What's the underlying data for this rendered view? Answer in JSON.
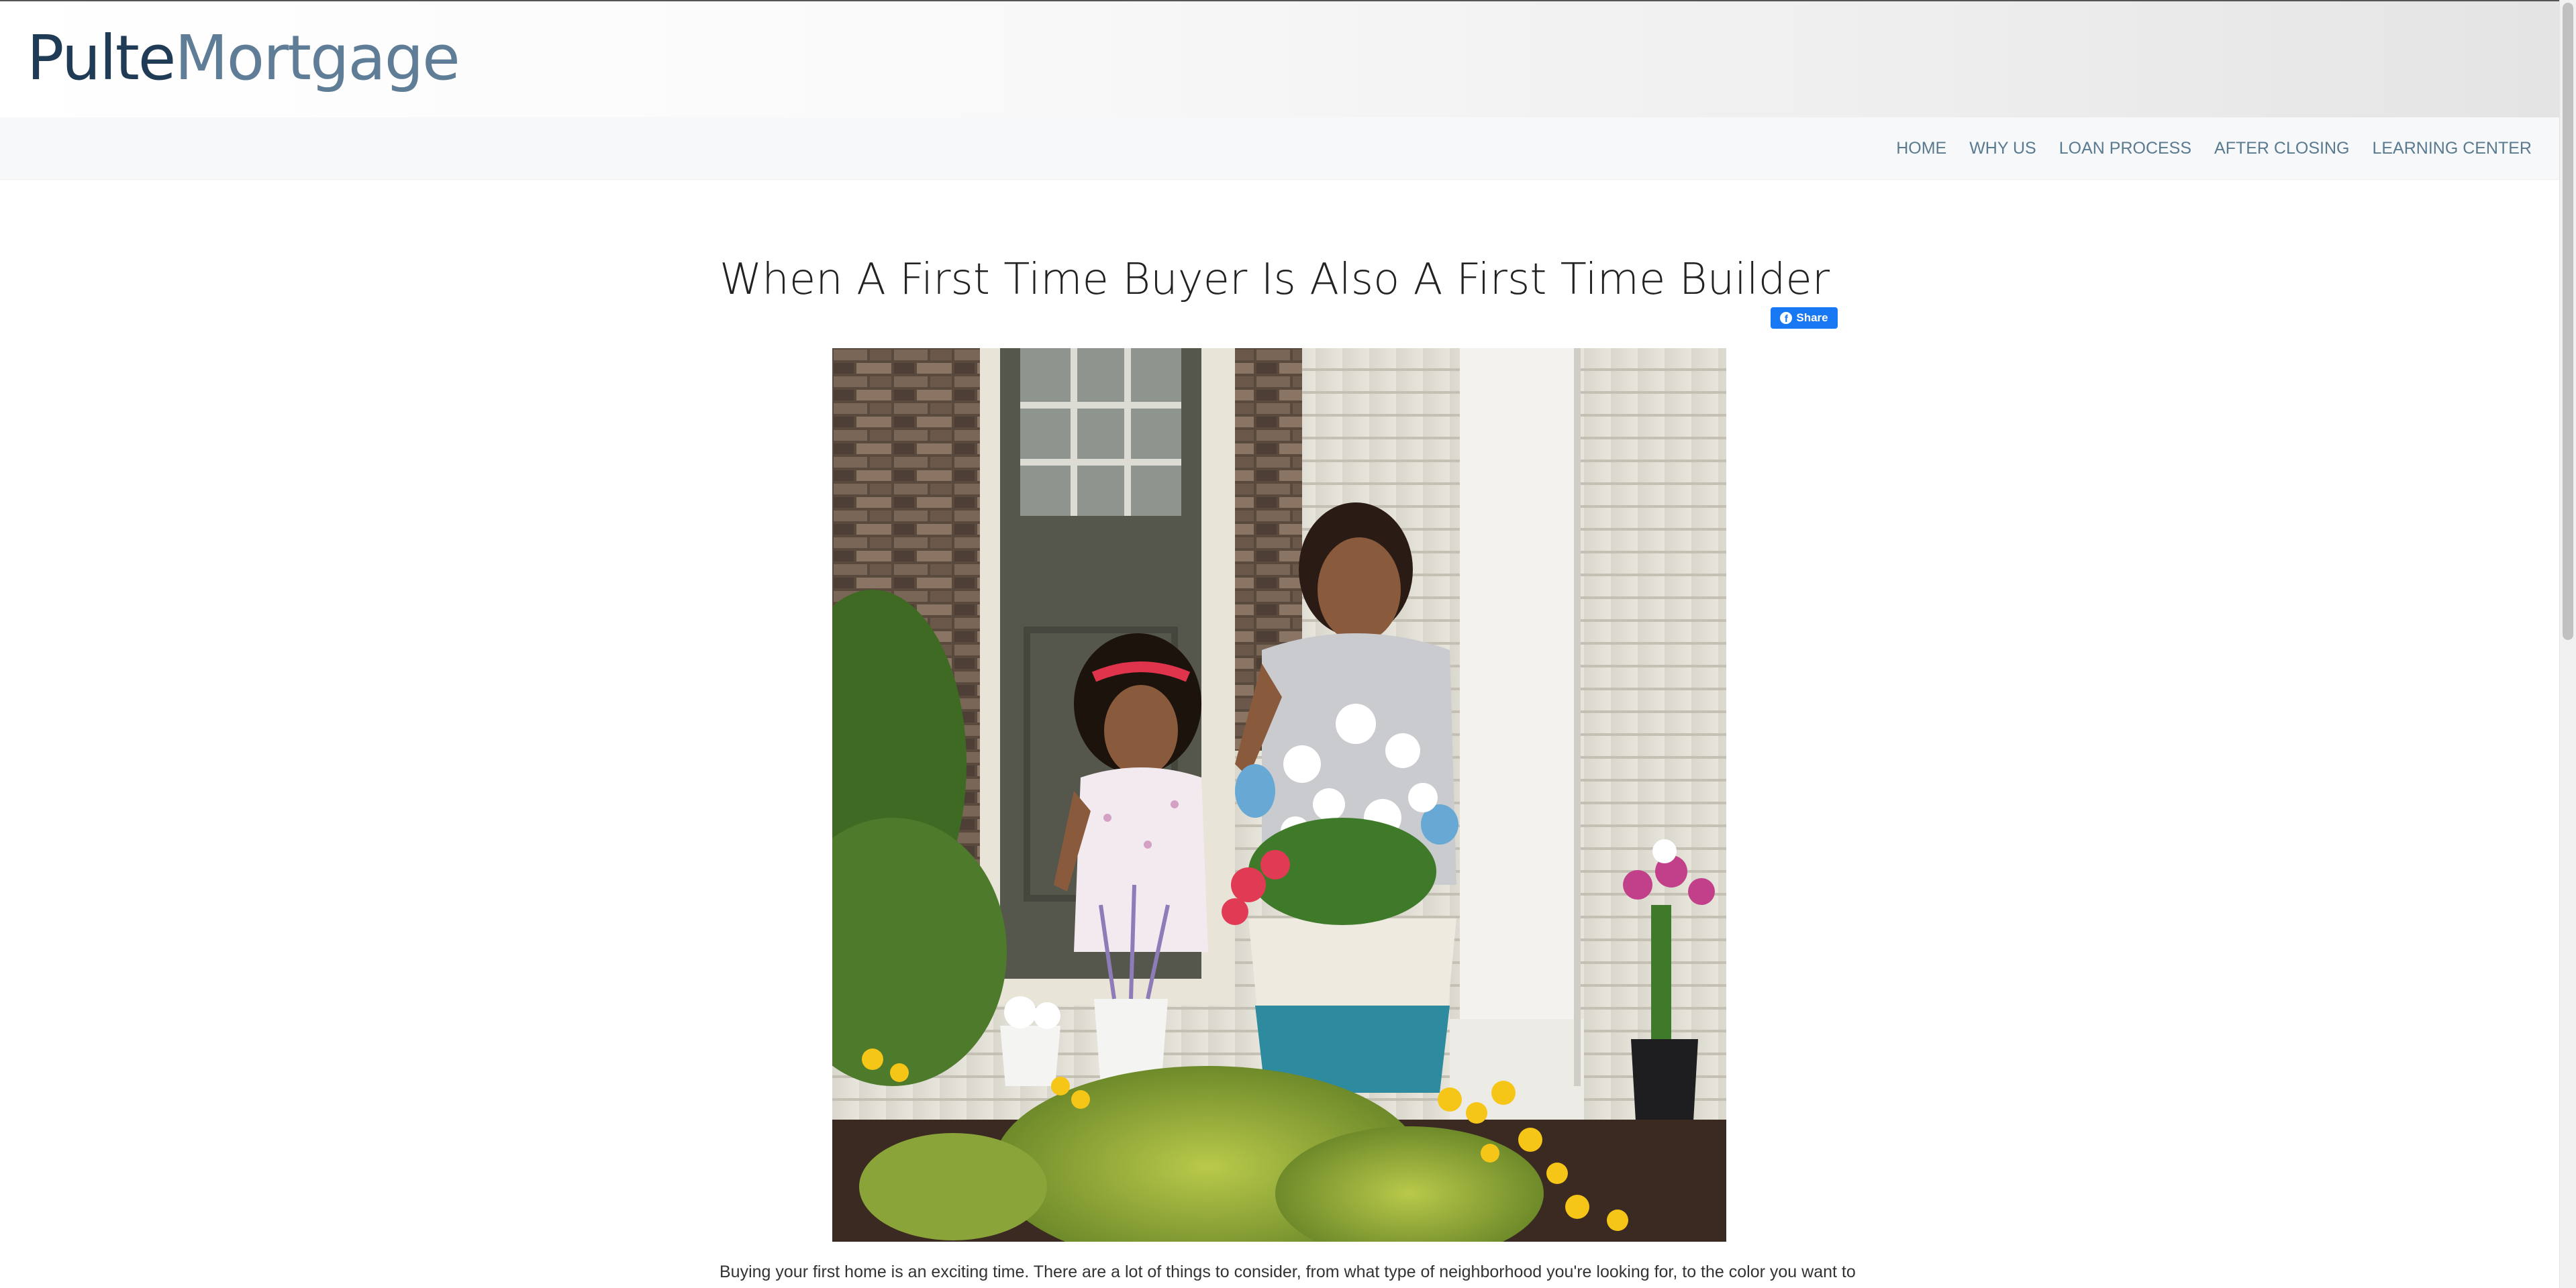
{
  "brand": {
    "logo_part1": "Pulte",
    "logo_part2": "Mortgage",
    "primary_color": "#1f3b55",
    "secondary_color": "#5f7d96"
  },
  "nav": {
    "items": [
      {
        "label": "HOME"
      },
      {
        "label": "WHY US"
      },
      {
        "label": "LOAN PROCESS"
      },
      {
        "label": "AFTER CLOSING"
      },
      {
        "label": "LEARNING CENTER"
      }
    ]
  },
  "article": {
    "title": "When A First Time Buyer Is Also A First Time Builder",
    "share_label": "Share",
    "share_icon": "facebook-icon",
    "share_color": "#1877f2",
    "photo_icon": "family-gardening-photo",
    "body_first_line": "Buying your first home is an exciting time. There are a lot of things to consider, from what type of neighborhood you're looking for, to the color you want to"
  }
}
